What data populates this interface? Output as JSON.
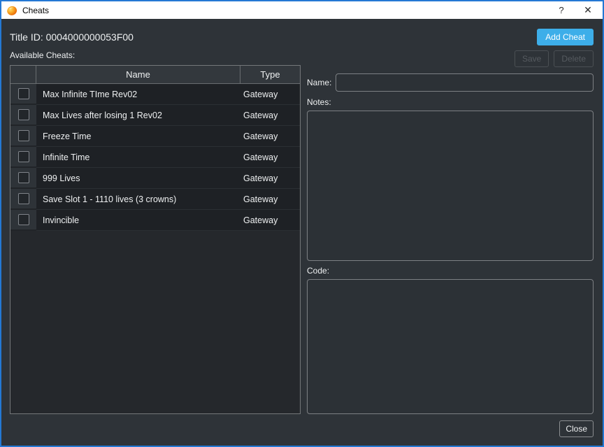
{
  "window": {
    "title": "Cheats",
    "help_label": "?",
    "close_label": "✕"
  },
  "header": {
    "title_id": "Title ID: 0004000000053F00",
    "add_cheat_label": "Add Cheat"
  },
  "cheats": {
    "section_label": "Available Cheats:",
    "columns": {
      "name": "Name",
      "type": "Type"
    },
    "rows": [
      {
        "name": "Max Infinite TIme Rev02",
        "type": "Gateway",
        "checked": false
      },
      {
        "name": "Max Lives after losing 1 Rev02",
        "type": "Gateway",
        "checked": false
      },
      {
        "name": "Freeze Time",
        "type": "Gateway",
        "checked": false
      },
      {
        "name": "Infinite Time",
        "type": "Gateway",
        "checked": false
      },
      {
        "name": "999 Lives",
        "type": "Gateway",
        "checked": false
      },
      {
        "name": "Save Slot 1 - 1110 lives (3 crowns)",
        "type": "Gateway",
        "checked": false
      },
      {
        "name": "Invincible",
        "type": "Gateway",
        "checked": false
      }
    ]
  },
  "editor": {
    "save_label": "Save",
    "delete_label": "Delete",
    "name_label": "Name:",
    "name_value": "",
    "notes_label": "Notes:",
    "notes_value": "",
    "code_label": "Code:",
    "code_value": ""
  },
  "footer": {
    "close_label": "Close"
  },
  "colors": {
    "accent": "#3daee9",
    "window_border": "#2478d4",
    "titlebar_bg": "#ffffff",
    "content_bg": "#2e3338",
    "table_bg": "#25282c",
    "row_bg": "#1e2125"
  }
}
